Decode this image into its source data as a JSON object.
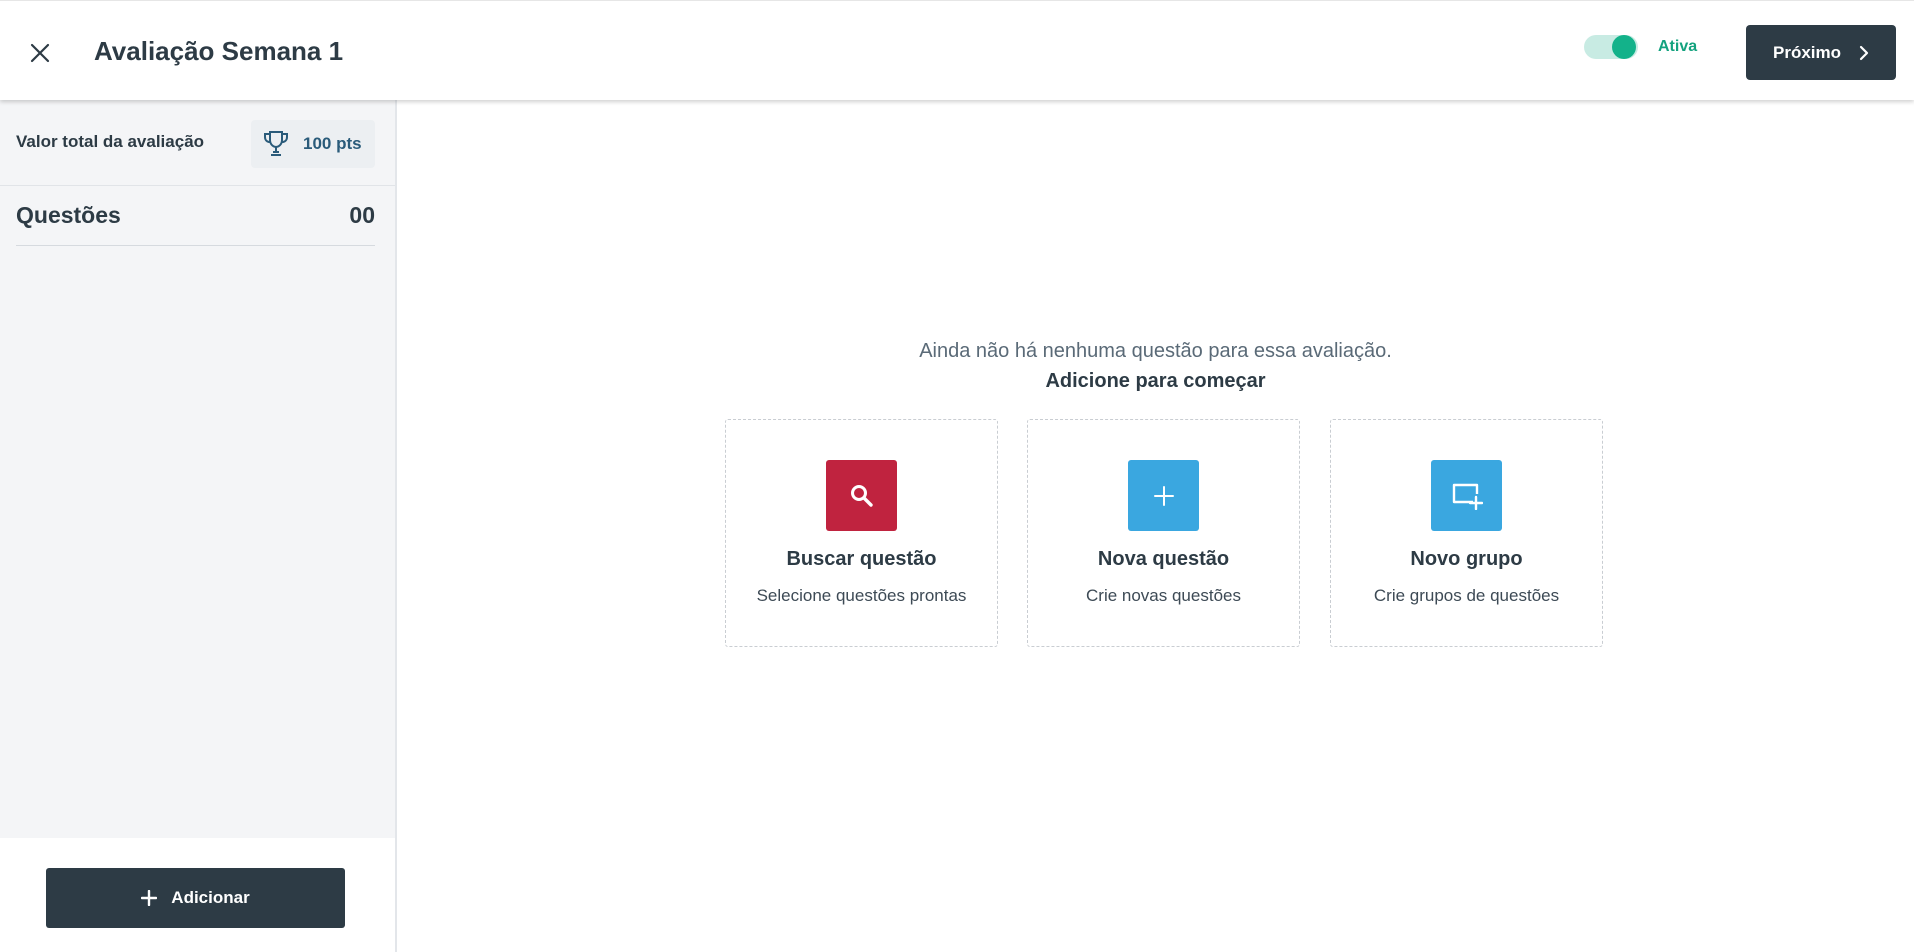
{
  "header": {
    "title": "Avaliação Semana 1",
    "toggle_label": "Ativa",
    "toggle_on": true,
    "next_label": "Próximo"
  },
  "sidebar": {
    "total_label": "Valor total da avaliação",
    "total_points": "100 pts",
    "questions_label": "Questões",
    "questions_count": "00",
    "add_label": "Adicionar"
  },
  "main": {
    "empty_message": "Ainda não há nenhuma questão para essa avaliação.",
    "empty_cta": "Adicione para começar",
    "cards": [
      {
        "title": "Buscar questão",
        "subtitle": "Selecione questões prontas",
        "icon": "search-icon",
        "color": "#c0233f"
      },
      {
        "title": "Nova questão",
        "subtitle": "Crie novas questões",
        "icon": "plus-icon",
        "color": "#3aa7e0"
      },
      {
        "title": "Novo grupo",
        "subtitle": "Crie grupos de questões",
        "icon": "add-group-icon",
        "color": "#3aa7e0"
      }
    ]
  },
  "colors": {
    "primary_dark": "#2d3b45",
    "toggle_active": "#13b28a",
    "danger": "#c0233f",
    "info": "#3aa7e0"
  }
}
